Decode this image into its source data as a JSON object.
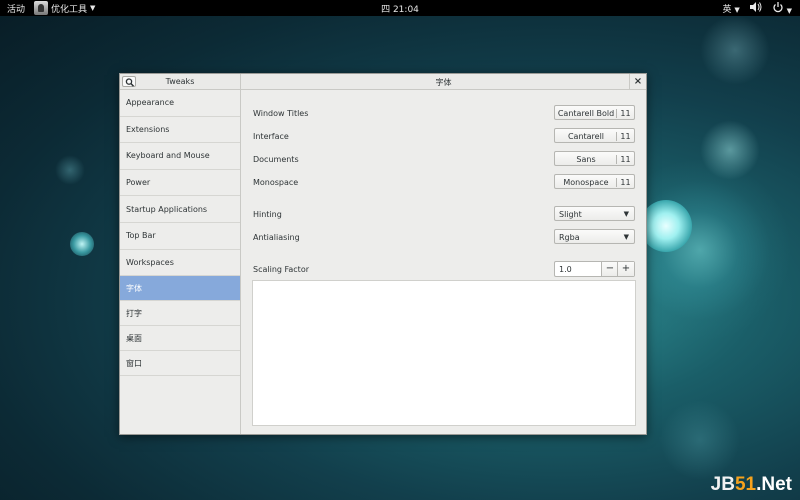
{
  "topbar": {
    "activities": "活动",
    "app_name": "优化工具",
    "clock": "四 21:04",
    "input_method": "英",
    "volume_icon": "volume-icon",
    "power_icon": "power-icon"
  },
  "window": {
    "sidebar_title": "Tweaks",
    "title": "字体",
    "close_label": "×"
  },
  "sidebar": {
    "items": [
      {
        "label": "Appearance"
      },
      {
        "label": "Extensions"
      },
      {
        "label": "Keyboard and Mouse"
      },
      {
        "label": "Power"
      },
      {
        "label": "Startup Applications"
      },
      {
        "label": "Top Bar"
      },
      {
        "label": "Workspaces"
      },
      {
        "label": "字体",
        "selected": true
      },
      {
        "label": "打字"
      },
      {
        "label": "桌面"
      },
      {
        "label": "窗口"
      }
    ]
  },
  "fonts": {
    "window_titles": {
      "label": "Window Titles",
      "font": "Cantarell Bold",
      "size": "11"
    },
    "interface": {
      "label": "Interface",
      "font": "Cantarell",
      "size": "11"
    },
    "documents": {
      "label": "Documents",
      "font": "Sans",
      "size": "11"
    },
    "monospace": {
      "label": "Monospace",
      "font": "Monospace",
      "size": "11"
    }
  },
  "hinting": {
    "label": "Hinting",
    "value": "Slight"
  },
  "antialiasing": {
    "label": "Antialiasing",
    "value": "Rgba"
  },
  "scaling": {
    "label": "Scaling Factor",
    "value": "1.0",
    "minus": "−",
    "plus": "+"
  },
  "watermark": {
    "j": "JB",
    "num": "51",
    "net": ".Net"
  },
  "colors": {
    "selected": "#86a9db",
    "accent": "#f5a21d"
  }
}
